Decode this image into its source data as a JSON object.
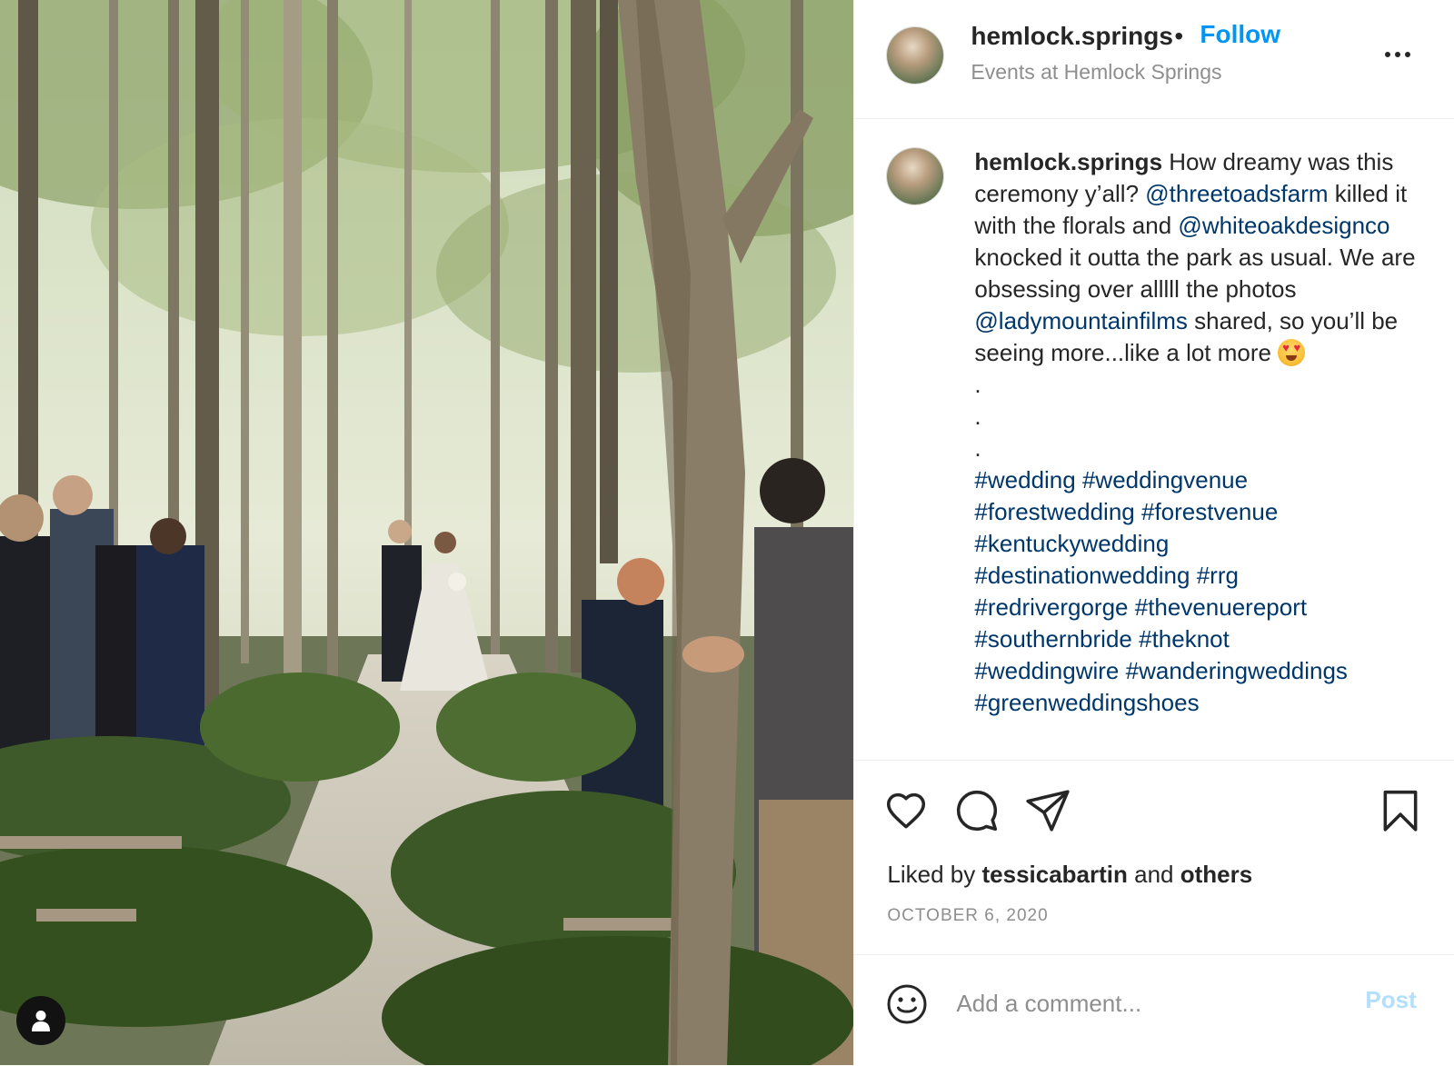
{
  "header": {
    "username": "hemlock.springs",
    "separator": "•",
    "follow_label": "Follow",
    "location": "Events at Hemlock Springs"
  },
  "caption": {
    "username": "hemlock.springs",
    "text_1": " How dreamy was this ceremony y’all? ",
    "mention_1": "@threetoadsfarm",
    "text_2": " killed it with the florals and ",
    "mention_2": "@whiteoakdesignco",
    "text_3": " knocked it outta the park as usual. We are obsessing over alllll the photos ",
    "mention_3": "@ladymountainfilms",
    "text_4": " shared, so you’ll be seeing more...like a lot more ",
    "emoji": "heart-eyes-emoji",
    "dots": [
      ".",
      ".",
      "."
    ],
    "hashtags": [
      "#wedding",
      "#weddingvenue",
      "#forestwedding",
      "#forestvenue",
      "#kentuckywedding",
      "#destinationwedding",
      "#rrg",
      "#redrivergorge",
      "#thevenuereport",
      "#southernbride",
      "#theknot",
      "#weddingwire",
      "#wanderingweddings",
      "#greenweddingshoes"
    ]
  },
  "actions": {
    "icons": [
      "heart-icon",
      "comment-icon",
      "share-icon",
      "bookmark-icon"
    ],
    "liked_prefix": "Liked by ",
    "liked_user": "tessicabartin",
    "liked_mid": " and ",
    "liked_others": "others",
    "date": "OCTOBER 6, 2020"
  },
  "comment": {
    "placeholder": "Add a comment...",
    "post_label": "Post"
  },
  "colors": {
    "accent": "#0095f6",
    "link": "#00376b",
    "muted": "#8e8e8e",
    "post_disabled": "#b2dffc"
  }
}
